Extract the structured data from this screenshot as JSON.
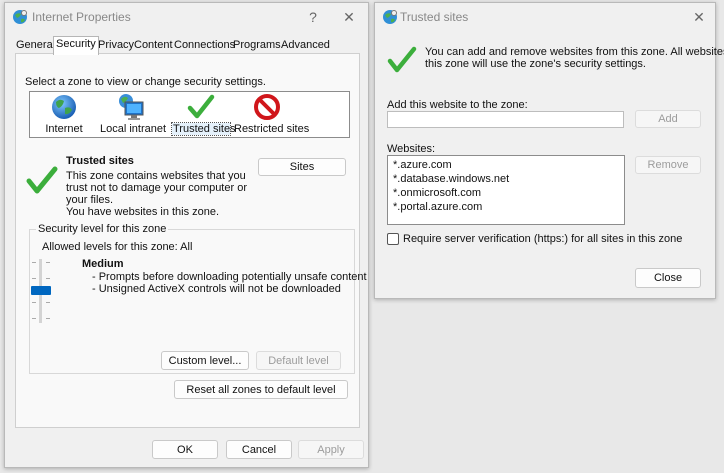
{
  "internet_properties": {
    "title": "Internet Properties",
    "help_glyph": "?",
    "close_glyph": "✕",
    "tabs": [
      "General",
      "Security",
      "Privacy",
      "Content",
      "Connections",
      "Programs",
      "Advanced"
    ],
    "active_tab": "Security",
    "zone_prompt": "Select a zone to view or change security settings.",
    "zones": [
      {
        "label": "Internet",
        "icon": "globe-icon"
      },
      {
        "label": "Local intranet",
        "icon": "network-computer-icon"
      },
      {
        "label": "Trusted sites",
        "icon": "green-check-icon"
      },
      {
        "label": "Restricted sites",
        "icon": "no-entry-icon"
      }
    ],
    "selected_zone": "Trusted sites",
    "zone_info": {
      "heading": "Trusted sites",
      "description_lines": [
        "This zone contains websites that you",
        "trust not to damage your computer or",
        "your files.",
        "You have websites in this zone."
      ]
    },
    "sites_button": "Sites",
    "security_level": {
      "group_title": "Security level for this zone",
      "allowed_levels": "Allowed levels for this zone: All",
      "level_name": "Medium",
      "bullets": [
        "- Prompts before downloading potentially unsafe content",
        "- Unsigned ActiveX controls will not be downloaded"
      ]
    },
    "custom_level_button": "Custom level...",
    "default_level_button": "Default level",
    "reset_all_button": "Reset all zones to default level",
    "ok_button": "OK",
    "cancel_button": "Cancel",
    "apply_button": "Apply"
  },
  "trusted_sites": {
    "title": "Trusted sites",
    "close_glyph": "✕",
    "info_lines": [
      "You can add and remove websites from this zone. All websites in",
      "this zone will use the zone's security settings."
    ],
    "add_label": "Add this website to the zone:",
    "add_input_value": "",
    "add_button": "Add",
    "websites_label": "Websites:",
    "websites": [
      "*.azure.com",
      "*.database.windows.net",
      "*.onmicrosoft.com",
      "*.portal.azure.com"
    ],
    "remove_button": "Remove",
    "require_verification_label": "Require server verification (https:) for all sites in this zone",
    "require_verification_checked": false,
    "close_button": "Close"
  }
}
